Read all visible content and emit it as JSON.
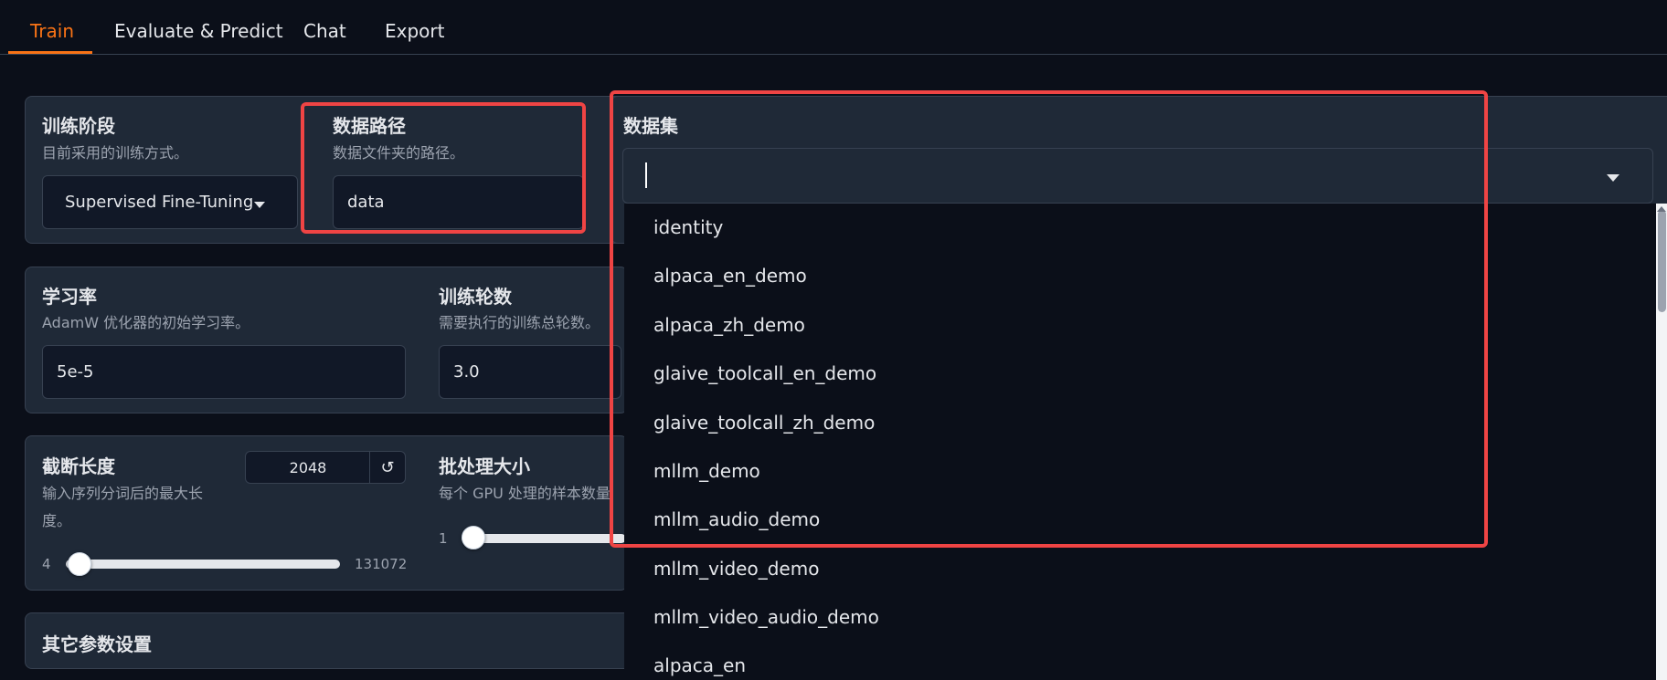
{
  "tabs": {
    "train": "Train",
    "evaluate": "Evaluate & Predict",
    "chat": "Chat",
    "export": "Export"
  },
  "training_stage": {
    "label": "训练阶段",
    "info": "目前采用的训练方式。",
    "value": "Supervised Fine-Tuning"
  },
  "data_path": {
    "label": "数据路径",
    "info": "数据文件夹的路径。",
    "value": "data"
  },
  "dataset": {
    "label": "数据集",
    "value": "",
    "options": [
      "identity",
      "alpaca_en_demo",
      "alpaca_zh_demo",
      "glaive_toolcall_en_demo",
      "glaive_toolcall_zh_demo",
      "mllm_demo",
      "mllm_audio_demo",
      "mllm_video_demo",
      "mllm_video_audio_demo",
      "alpaca_en"
    ]
  },
  "learning_rate": {
    "label": "学习率",
    "info": "AdamW 优化器的初始学习率。",
    "value": "5e-5"
  },
  "epochs": {
    "label": "训练轮数",
    "info": "需要执行的训练总轮数。",
    "value": "3.0"
  },
  "cutoff_len": {
    "label": "截断长度",
    "info_line1": "输入序列分词后的最大长",
    "info_line2": "度。",
    "value": "2048",
    "reset_icon": "↺",
    "min": "4",
    "max": "131072",
    "level": 0.015
  },
  "batch_size": {
    "label": "批处理大小",
    "info": "每个 GPU 处理的样本数量",
    "min": "1",
    "level": 0
  },
  "other_settings": {
    "label": "其它参数设置"
  },
  "icons": {
    "dropdown": "chevron-down-icon",
    "reset": "reset-icon"
  },
  "colors": {
    "accent": "#f97316",
    "highlight": "#ef4444",
    "background": "#0b0f19",
    "panel": "#1f2937"
  }
}
